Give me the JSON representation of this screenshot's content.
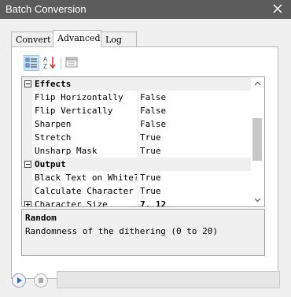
{
  "window": {
    "title": "Batch Conversion"
  },
  "tabs": [
    {
      "label": "Convert",
      "active": false
    },
    {
      "label": "Advanced",
      "active": true
    },
    {
      "label": "Log",
      "active": false
    }
  ],
  "toolbar": {
    "buttons": [
      {
        "icon": "categorized-view-icon",
        "pressed": true
      },
      {
        "icon": "alphabetical-sort-icon",
        "pressed": false
      },
      {
        "icon": "property-pages-icon",
        "pressed": false
      }
    ]
  },
  "grid": {
    "categories": [
      {
        "name": "Effects",
        "expanded": true,
        "properties": [
          {
            "name": "Flip Horizontally",
            "value": "False"
          },
          {
            "name": "Flip Vertically",
            "value": "False"
          },
          {
            "name": "Sharpen",
            "value": "False"
          },
          {
            "name": "Stretch",
            "value": "True"
          },
          {
            "name": "Unsharp Mask",
            "value": "True"
          }
        ]
      },
      {
        "name": "Output",
        "expanded": true,
        "properties": [
          {
            "name": "Black Text on White?",
            "value": "True"
          },
          {
            "name": "Calculate Character S",
            "value": "True"
          },
          {
            "name": "Character Size",
            "value": "7, 12",
            "expandable": true
          }
        ]
      }
    ]
  },
  "help": {
    "title": "Random",
    "description": "Randomness of the dithering (0 to 20)"
  },
  "colors": {
    "titlebar": "#5c5c5c",
    "window_background": "#f0f0f0",
    "pressed_button": "#cce4f7"
  }
}
